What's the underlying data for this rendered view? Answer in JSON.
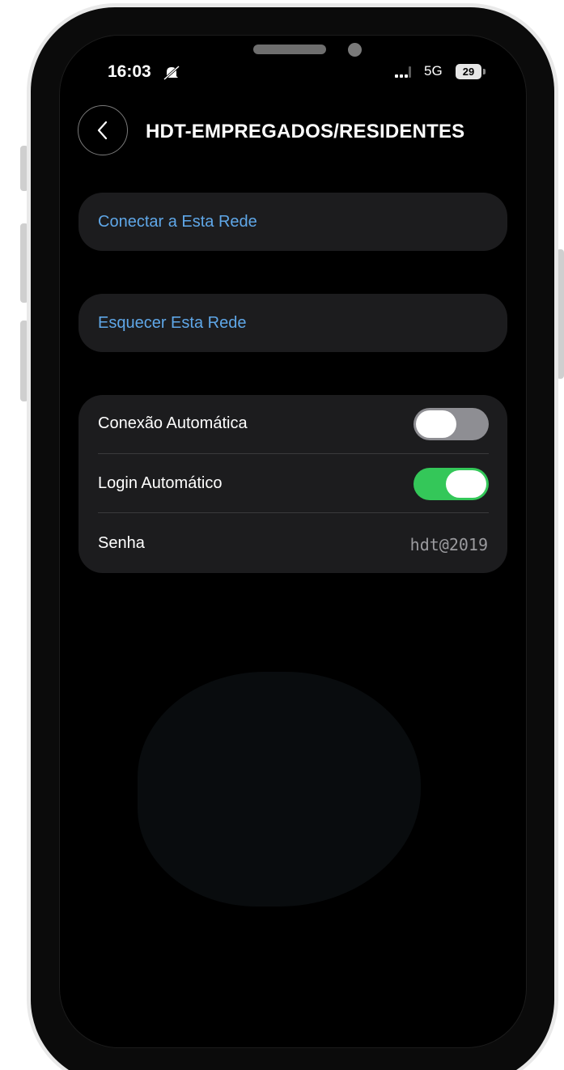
{
  "status_bar": {
    "time": "16:03",
    "network": "5G",
    "battery": "29"
  },
  "header": {
    "title": "HDT-EMPREGADOS/RESIDENTES"
  },
  "actions": {
    "connect_label": "Conectar a Esta Rede",
    "forget_label": "Esquecer Esta Rede"
  },
  "settings": {
    "auto_connect": {
      "label": "Conexão Automática",
      "enabled": false
    },
    "auto_login": {
      "label": "Login Automático",
      "enabled": true
    },
    "password": {
      "label": "Senha",
      "value": "hdt@2019"
    }
  },
  "colors": {
    "link": "#5fa7e8",
    "toggle_on": "#34c759",
    "toggle_off": "#8e8e93",
    "card": "#1c1c1e"
  },
  "icons": {
    "back": "chevron-left-icon",
    "mute": "bell-slash-icon",
    "signal": "cellular-signal-icon",
    "battery": "battery-icon"
  }
}
